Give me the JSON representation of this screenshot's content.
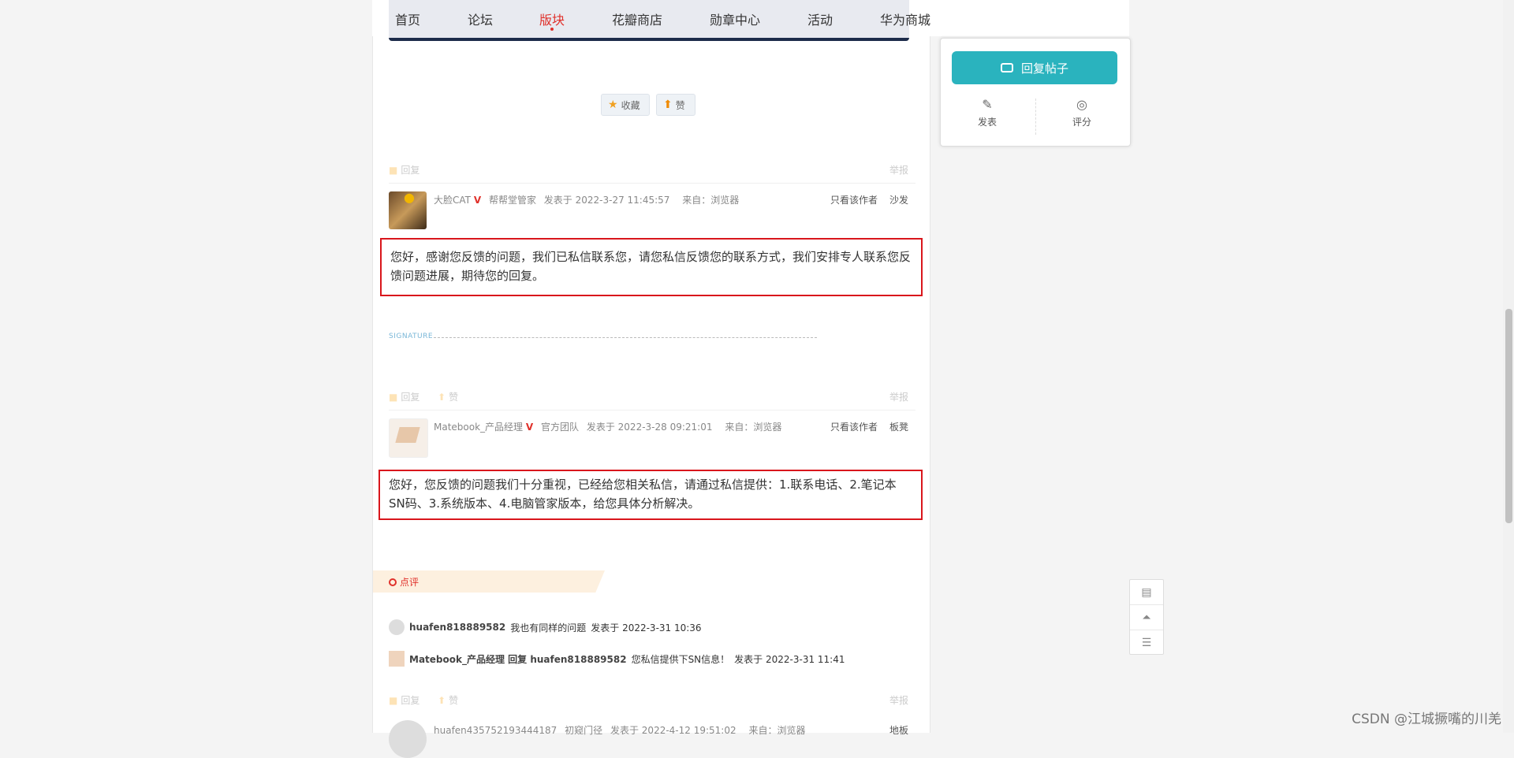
{
  "nav": {
    "items": [
      "首页",
      "论坛",
      "版块",
      "花瓣商店",
      "勋章中心",
      "活动",
      "华为商城"
    ],
    "active_index": 2
  },
  "actions": {
    "favorite": "收藏",
    "like": "赞"
  },
  "post1": {
    "footer_reply": "回复",
    "footer_report": "举报",
    "author": "大脸CAT",
    "v_badge": "V",
    "role": "帮帮堂管家",
    "time": "发表于 2022-3-27 11:45:57",
    "source": "来自：浏览器",
    "only_author": "只看该作者",
    "floor": "沙发",
    "content": "您好，感谢您反馈的问题，我们已私信联系您，请您私信反馈您的联系方式，我们安排专人联系您反馈问题进展，期待您的回复。"
  },
  "signature_label": "SIGNATURE",
  "post2": {
    "footer_reply": "回复",
    "footer_like": "赞",
    "footer_report": "举报",
    "author": "Matebook_产品经理",
    "v_badge": "V",
    "role": "官方团队",
    "time": "发表于 2022-3-28 09:21:01",
    "source": "来自：浏览器",
    "only_author": "只看该作者",
    "floor": "板凳",
    "content": "您好，您反馈的问题我们十分重视，已经给您相关私信，请通过私信提供：1.联系电话、2.笔记本SN码、3.系统版本、4.电脑管家版本，给您具体分析解决。"
  },
  "comments": {
    "label": "点评",
    "items": [
      {
        "user": "huafen818889582",
        "text": "我也有同样的问题",
        "time": "发表于 2022-3-31 10:36"
      },
      {
        "user": "Matebook_产品经理 回复 huafen818889582",
        "text": "您私信提供下SN信息！",
        "time": "发表于 2022-3-31 11:41"
      }
    ]
  },
  "post3": {
    "footer_reply": "回复",
    "footer_like": "赞",
    "footer_report": "举报",
    "author": "huafen435752193444187",
    "role": "初窥门径",
    "time": "发表于 2022-4-12 19:51:02",
    "source": "来自：浏览器",
    "floor": "地板"
  },
  "sidebar": {
    "reply_button": "回复帖子",
    "post": "发表",
    "rate": "评分"
  },
  "watermark": "CSDN @江城撅嘴的川羌",
  "colors": {
    "accent": "#2ab3be",
    "highlight_border": "#d9161c",
    "active_nav": "#e0312b"
  }
}
